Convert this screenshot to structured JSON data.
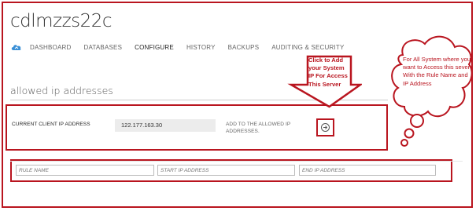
{
  "header": {
    "title": "cdlmzzs22c"
  },
  "nav": {
    "items": [
      {
        "label": "DASHBOARD"
      },
      {
        "label": "DATABASES"
      },
      {
        "label": "CONFIGURE"
      },
      {
        "label": "HISTORY"
      },
      {
        "label": "BACKUPS"
      },
      {
        "label": "AUDITING & SECURITY"
      }
    ]
  },
  "section": {
    "title": "allowed ip addresses"
  },
  "current_ip": {
    "label": "CURRENT CLIENT IP ADDRESS",
    "value": "122.177.163.30",
    "add_text": "ADD TO THE ALLOWED IP ADDRESSES."
  },
  "rule": {
    "name_placeholder": "RULE NAME",
    "start_placeholder": "START IP ADDRESS",
    "end_placeholder": "END IP ADDRESS"
  },
  "annotations": {
    "arrow_text": "Click to Add your System IP For Access This Server",
    "cloud_text": "For All System where you want to Access this sever With the Rule Name and IP Address",
    "annotation_color": "#b9151f"
  }
}
